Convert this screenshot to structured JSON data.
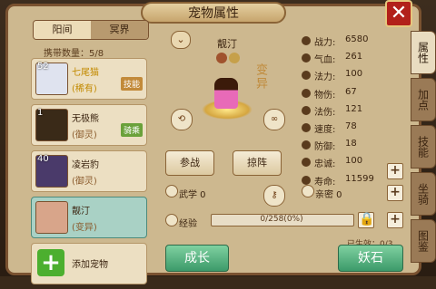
{
  "window": {
    "title": "宠物属性",
    "close_icon": "close-icon"
  },
  "realm_tabs": [
    {
      "label": "阳间",
      "active": true
    },
    {
      "label": "冥界",
      "active": false
    }
  ],
  "carry": "携带数量：5/8",
  "pets": [
    {
      "level": "52",
      "name": "七尾猫",
      "sub": "(稀有)",
      "badge": "技能",
      "badge_color": "#c28a3a",
      "ava_color": "#dfe3ef"
    },
    {
      "level": "1",
      "name": "无极熊",
      "sub": "(御灵)",
      "badge": "骑乘",
      "badge_color": "#6aa13a",
      "ava_color": "#3a2a18"
    },
    {
      "level": "40",
      "name": "凌岩豹",
      "sub": "(御灵)",
      "badge": "",
      "badge_color": "",
      "ava_color": "#4a3a6a"
    },
    {
      "level": "",
      "name": "靓汀",
      "sub": "(变异)",
      "badge": "",
      "badge_color": "",
      "ava_color": "#d8a58a",
      "selected": true
    }
  ],
  "add_pet": "添加宠物",
  "pet_name": "靓汀",
  "stamp": "变异",
  "buttons": {
    "fight": "参战",
    "formation": "掠阵",
    "grow": "成长",
    "evil_stone": "妖石"
  },
  "stats": [
    {
      "label": "战力:",
      "value": "6580"
    },
    {
      "label": "气血:",
      "value": "261"
    },
    {
      "label": "法力:",
      "value": "100"
    },
    {
      "label": "物伤:",
      "value": "67"
    },
    {
      "label": "法伤:",
      "value": "121"
    },
    {
      "label": "速度:",
      "value": "78"
    },
    {
      "label": "防御:",
      "value": "18"
    },
    {
      "label": "忠诚:",
      "value": "100"
    },
    {
      "label": "寿命:",
      "value": "11599"
    }
  ],
  "wuxue": "武学 0",
  "qinmi": "亲密 0",
  "exp_label": "经验",
  "exp_value": "0/258(0%)",
  "exp_progress": 0,
  "active_info": "已生效：0/3",
  "side_tabs": [
    "属性",
    "加点",
    "技能",
    "坐骑",
    "图鉴"
  ]
}
